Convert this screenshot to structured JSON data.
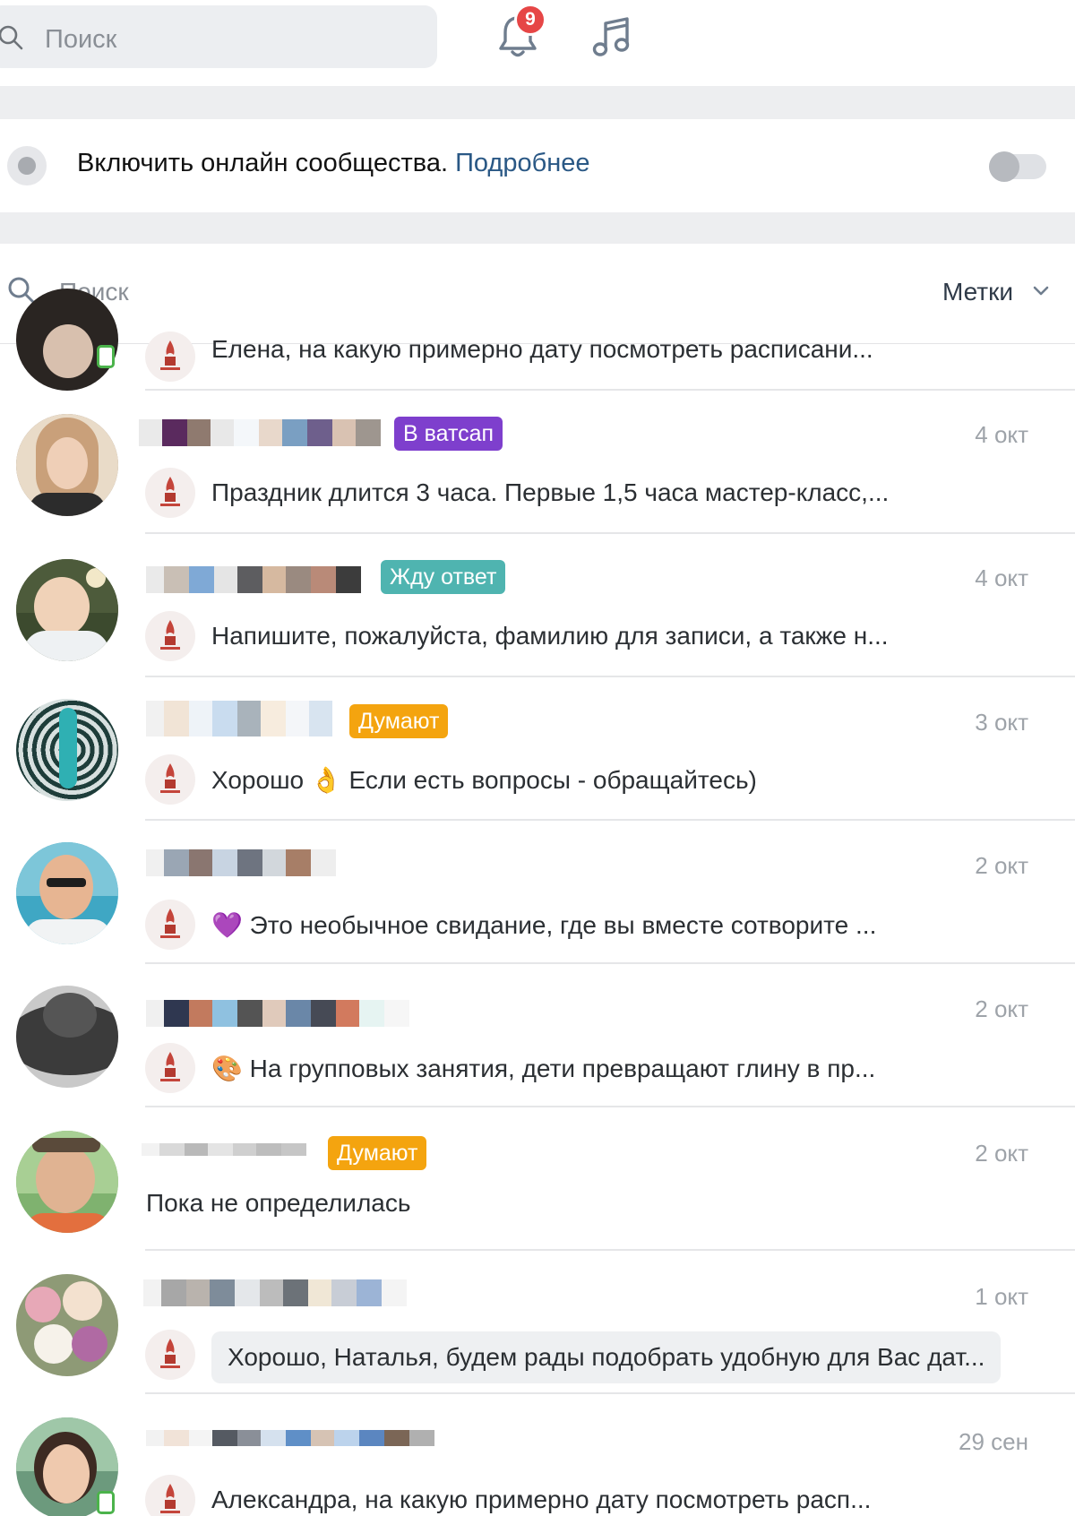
{
  "top": {
    "search_placeholder": "Поиск",
    "notifications_count": "9"
  },
  "online_banner": {
    "text": "Включить онлайн сообщества.",
    "link": "Подробнее"
  },
  "dialogs": {
    "search_placeholder": "Поиск",
    "labels_button": "Метки"
  },
  "conversations": [
    {
      "tag": "",
      "date": "",
      "message": "Елена, на какую примерно дату посмотреть расписани..."
    },
    {
      "tag": "В ватсап",
      "tag_color": "#7e3fcd",
      "date": "4 окт",
      "message": "Праздник длится 3 часа. Первые 1,5 часа мастер-класс,..."
    },
    {
      "tag": "Жду ответ",
      "tag_color": "#4fb4b0",
      "date": "4 окт",
      "message": "Напишите, пожалуйста, фамилию для записи, а также н..."
    },
    {
      "tag": "Думают",
      "tag_color": "#f4a40f",
      "date": "3 окт",
      "message": "Хорошо 👌 Если есть вопросы - обращайтесь)"
    },
    {
      "tag": "",
      "date": "2 окт",
      "message": "💜 Это необычное свидание, где вы вместе сотворите ..."
    },
    {
      "tag": "",
      "date": "2 окт",
      "message": "🎨 На групповых занятия, дети превращают глину в пр..."
    },
    {
      "tag": "Думают",
      "tag_color": "#f4a40f",
      "date": "2 окт",
      "message": "Пока не определилась"
    },
    {
      "tag": "",
      "date": "1 окт",
      "message": "Хорошо, Наталья, будем рады подобрать удобную для Вас дат..."
    },
    {
      "tag": "",
      "date": "29 сен",
      "message": "Александра, на какую примерно дату посмотреть расп..."
    }
  ]
}
